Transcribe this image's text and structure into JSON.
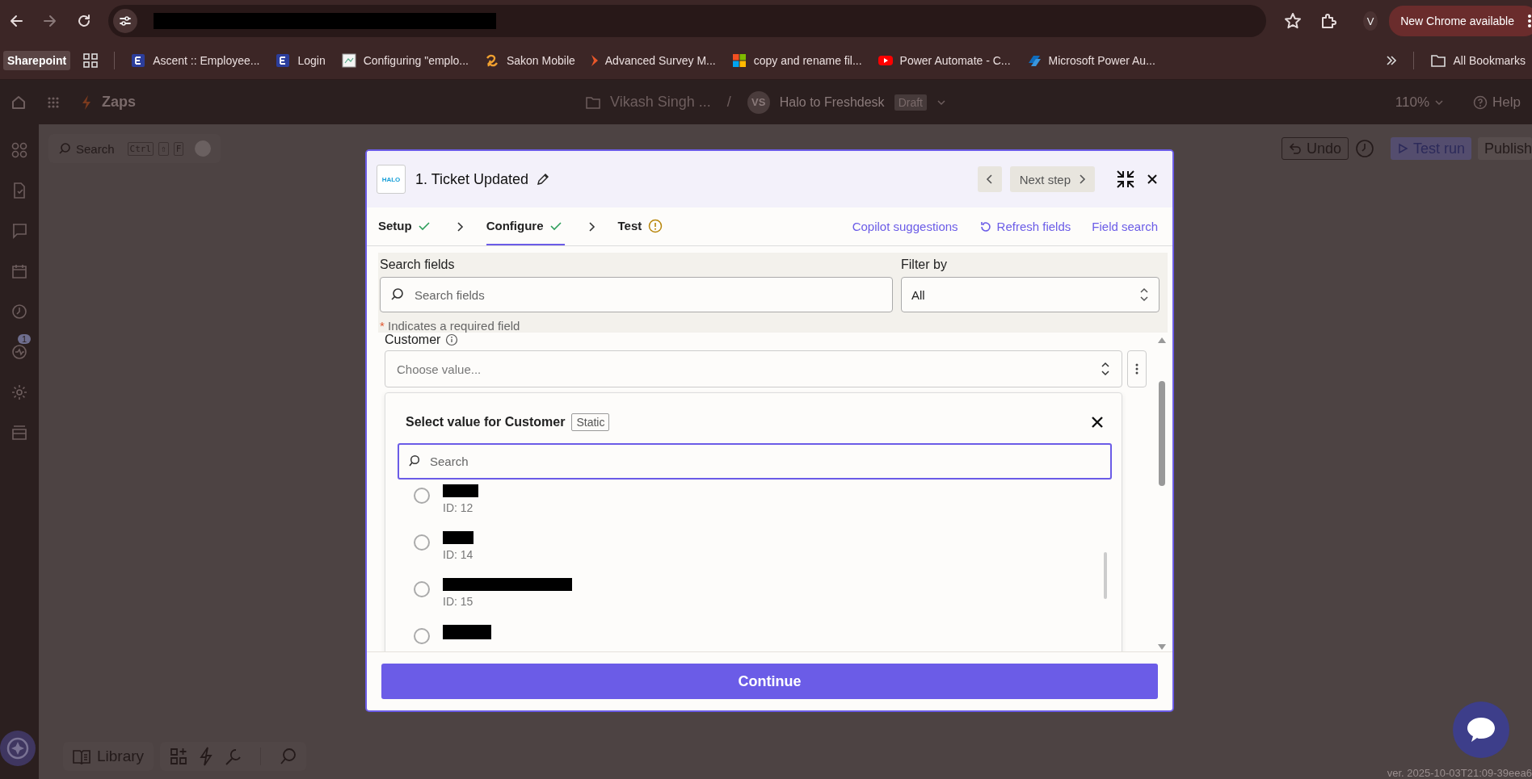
{
  "browser": {
    "profile_initial": "V",
    "update_button": "New Chrome available"
  },
  "bookmarks": [
    {
      "label": "Sharepoint",
      "kind": "chip"
    },
    {
      "label": "Ascent :: Employee...",
      "kind": "letter"
    },
    {
      "label": "Login",
      "kind": "letter"
    },
    {
      "label": "Configuring \"emplo...",
      "kind": "page"
    },
    {
      "label": "Sakon Mobile",
      "kind": "sakon"
    },
    {
      "label": "Advanced Survey M...",
      "kind": "survey"
    },
    {
      "label": "copy and rename fil...",
      "kind": "windows"
    },
    {
      "label": "Power Automate - C...",
      "kind": "video"
    },
    {
      "label": "Microsoft Power Au...",
      "kind": "flow"
    }
  ],
  "all_bookmarks": "All Bookmarks",
  "app_header": {
    "title": "Zaps",
    "folder": "Vikash Singh ...",
    "separator": "/",
    "avatar": "VS",
    "zap_name": "Halo to Freshdesk",
    "badge": "Draft",
    "zoom": "110%",
    "help": "Help"
  },
  "rail": {
    "badge": "1"
  },
  "canvas_toolbar": {
    "search": "Search",
    "shortcut": [
      "Ctrl",
      "⇧",
      "F"
    ],
    "undo": "Undo",
    "test_run": "Test run",
    "publish": "Publish"
  },
  "bottom_toolbar": {
    "library": "Library"
  },
  "version": "ver. 2025-10-03T21:09-39eea6",
  "modal": {
    "logo": "HALO",
    "title": "1. Ticket Updated",
    "next_step": "Next step",
    "tabs": [
      {
        "label": "Setup",
        "complete": true,
        "selected": false
      },
      {
        "label": "Configure",
        "complete": true,
        "selected": true
      },
      {
        "label": "Test",
        "complete": false,
        "selected": false
      }
    ],
    "actions": [
      "Copilot suggestions",
      "Refresh fields",
      "Field search"
    ],
    "search_fields": {
      "label": "Search fields",
      "placeholder": "Search fields"
    },
    "filter": {
      "label": "Filter by",
      "value": "All"
    },
    "required_mark": "*",
    "required_note": "Indicates a required field",
    "field": {
      "label": "Customer",
      "placeholder": "Choose value..."
    },
    "dropdown": {
      "title": "Select value for Customer",
      "tag": "Static",
      "search_placeholder": "Search",
      "options": [
        {
          "id_label": "ID: 12",
          "selected": false
        },
        {
          "id_label": "ID: 14",
          "selected": false
        },
        {
          "id_label": "ID: 15",
          "selected": false
        },
        {
          "selected": false
        }
      ]
    },
    "button": "Continue"
  }
}
